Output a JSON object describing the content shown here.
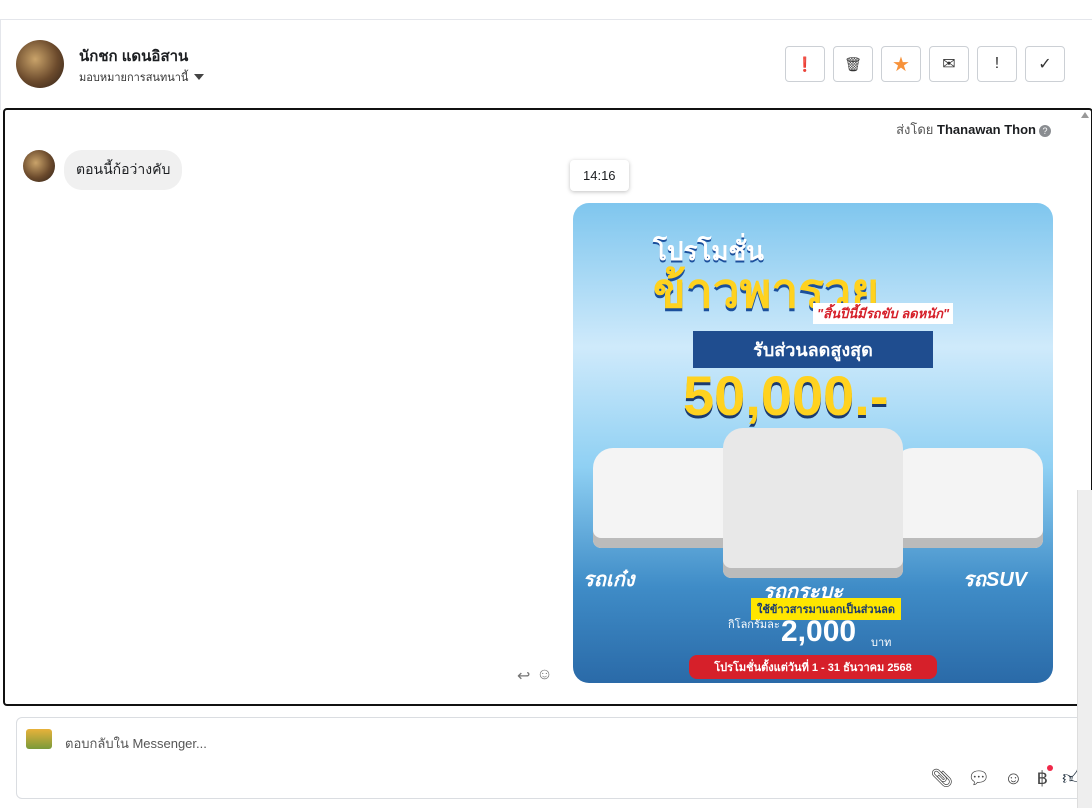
{
  "header": {
    "name": "นักชก แดนอิสาน",
    "assign_label": "มอบหมายการสนทนานี้"
  },
  "actions": [
    {
      "name": "spam",
      "glyph": "❗"
    },
    {
      "name": "delete",
      "glyph": "🗑"
    },
    {
      "name": "star",
      "glyph": "★"
    },
    {
      "name": "mark-unread",
      "glyph": "✉"
    },
    {
      "name": "important",
      "glyph": "!"
    },
    {
      "name": "done",
      "glyph": "✓"
    }
  ],
  "thread": {
    "sent_by_label": "ส่งโดย",
    "sent_by_name": "Thanawan Thon",
    "incoming_message": "ตอนนี้ก้อว่างคับ",
    "timestamp": "14:16"
  },
  "ad": {
    "line1": "โปรโมชั่น",
    "line2": "ข้าวพารวย",
    "tagline": "\"สิ้นปีนี้มีรถขับ ลดหนัก\"",
    "discount_label": "รับส่วนลดสูงสุด",
    "discount": "50,000.-",
    "sedan": "รถเก๋ง",
    "pickup": "รถกระบะ",
    "suv": "รถSUV",
    "rice": "ใช้ข้าวสารมาแลกเป็นส่วนลด",
    "per_kg": "กิโลกรัมละ",
    "price": "2,000",
    "baht": "บาท",
    "period": "โปรโมชั่นตั้งแต่วันที่ 1 - 31 ธันวาคม 2568"
  },
  "composer": {
    "placeholder": "ตอบกลับใน Messenger..."
  },
  "colors": {
    "star": "#f7923a",
    "like": "#1c2b3a"
  }
}
